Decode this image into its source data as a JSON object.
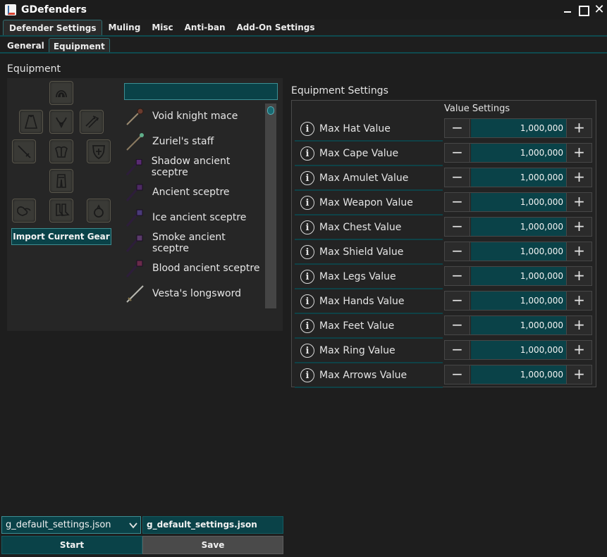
{
  "window": {
    "title": "GDefenders"
  },
  "main_tabs": [
    {
      "label": "Defender Settings",
      "active": true
    },
    {
      "label": "Muling",
      "active": false
    },
    {
      "label": "Misc",
      "active": false
    },
    {
      "label": "Anti-ban",
      "active": false
    },
    {
      "label": "Add-On Settings",
      "active": false
    }
  ],
  "sub_tabs": [
    {
      "label": "General",
      "active": false
    },
    {
      "label": "Equipment",
      "active": true
    }
  ],
  "equipment": {
    "heading": "Equipment",
    "import_label": "Import Current Gear",
    "search_value": "",
    "slots": [
      "hat-slot-icon",
      "cape-slot-icon",
      "amulet-slot-icon",
      "arrows-slot-icon",
      "weapon-slot-icon",
      "chest-slot-icon",
      "shield-slot-icon",
      "legs-slot-icon",
      "hands-slot-icon",
      "feet-slot-icon",
      "ring-slot-icon"
    ],
    "items": [
      "Void knight mace",
      "Zuriel's staff",
      "Shadow ancient sceptre",
      "Ancient sceptre",
      "Ice ancient sceptre",
      "Smoke ancient sceptre",
      "Blood ancient sceptre",
      "Vesta's longsword"
    ]
  },
  "settings": {
    "heading": "Equipment Settings",
    "column_header": "Value Settings",
    "rows": [
      {
        "label": "Max Hat Value",
        "value": "1,000,000"
      },
      {
        "label": "Max Cape Value",
        "value": "1,000,000"
      },
      {
        "label": "Max Amulet Value",
        "value": "1,000,000"
      },
      {
        "label": "Max Weapon Value",
        "value": "1,000,000"
      },
      {
        "label": "Max Chest Value",
        "value": "1,000,000"
      },
      {
        "label": "Max Shield Value",
        "value": "1,000,000"
      },
      {
        "label": "Max Legs Value",
        "value": "1,000,000"
      },
      {
        "label": "Max Hands Value",
        "value": "1,000,000"
      },
      {
        "label": "Max Feet Value",
        "value": "1,000,000"
      },
      {
        "label": "Max Ring Value",
        "value": "1,000,000"
      },
      {
        "label": "Max Arrows Value",
        "value": "1,000,000"
      }
    ],
    "minus_symbol": "−",
    "plus_symbol": "+",
    "info_symbol": "i"
  },
  "footer": {
    "profile_select": "g_default_settings.json",
    "profile_name": "g_default_settings.json",
    "start_label": "Start",
    "save_label": "Save"
  },
  "colors": {
    "accent": "#0a4248",
    "accent_border": "#3b8f94",
    "background": "#1e1e1e"
  }
}
